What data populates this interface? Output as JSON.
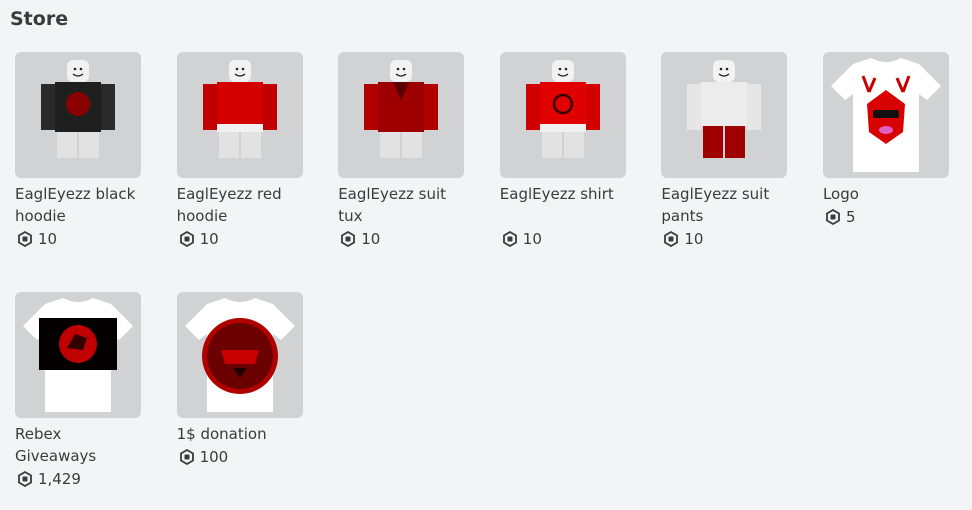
{
  "store": {
    "title": "Store",
    "items": [
      {
        "name": "EaglEyezz black hoodie",
        "price": "10",
        "thumb_icon": "avatar-black-hoodie-thumbnail"
      },
      {
        "name": "EaglEyezz red hoodie",
        "price": "10",
        "thumb_icon": "avatar-red-hoodie-thumbnail"
      },
      {
        "name": "EaglEyezz suit tux",
        "price": "10",
        "thumb_icon": "avatar-suit-tux-thumbnail"
      },
      {
        "name": "EaglEyezz shirt",
        "price": "10",
        "thumb_icon": "avatar-shirt-thumbnail"
      },
      {
        "name": "EaglEyezz suit pants",
        "price": "10",
        "thumb_icon": "avatar-suit-pants-thumbnail"
      },
      {
        "name": "Logo",
        "price": "5",
        "thumb_icon": "tshirt-logo-thumbnail"
      },
      {
        "name": "Rebex Giveaways",
        "price": "1,429",
        "thumb_icon": "tshirt-rebex-thumbnail"
      },
      {
        "name": "1$ donation",
        "price": "100",
        "thumb_icon": "tshirt-donation-thumbnail"
      }
    ]
  },
  "colors": {
    "background": "#f2f4f5",
    "thumb_bg": "#d0d2d4",
    "text": "#393b3d",
    "accent_red": "#d40000"
  }
}
